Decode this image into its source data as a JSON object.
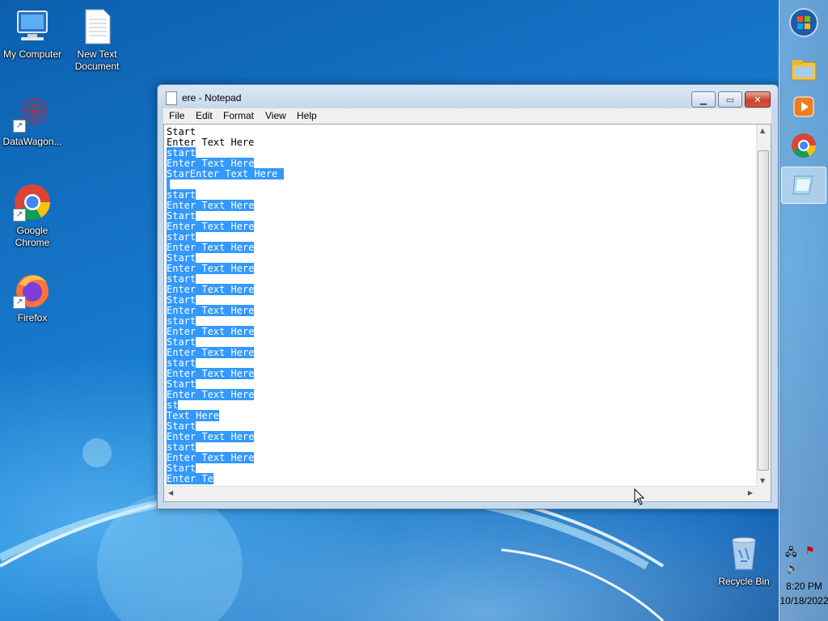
{
  "desktop": {
    "icons": [
      {
        "label": "My Computer",
        "icon": "computer-icon"
      },
      {
        "label": "New Text Document",
        "icon": "text-document-icon"
      },
      {
        "label": "DataWagon...",
        "icon": "datawagon-icon"
      },
      {
        "label": "Google Chrome",
        "icon": "chrome-icon"
      },
      {
        "label": "Firefox",
        "icon": "firefox-icon"
      },
      {
        "label": "Recycle Bin",
        "icon": "recycle-bin-icon"
      }
    ]
  },
  "notepad": {
    "title": "ere - Notepad",
    "menu": [
      "File",
      "Edit",
      "Format",
      "View",
      "Help"
    ],
    "lines": [
      {
        "text": "Start",
        "selected": false
      },
      {
        "text": "Enter Text Here",
        "selected": false
      },
      {
        "text": "start",
        "selected": true
      },
      {
        "text": "Enter Text Here",
        "selected": true
      },
      {
        "text": "StarEnter Text Here ",
        "selected": true
      },
      {
        "text": "",
        "selected": true
      },
      {
        "text": "start",
        "selected": true
      },
      {
        "text": "Enter Text Here",
        "selected": true
      },
      {
        "text": "Start",
        "selected": true
      },
      {
        "text": "Enter Text Here",
        "selected": true
      },
      {
        "text": "start",
        "selected": true
      },
      {
        "text": "Enter Text Here",
        "selected": true
      },
      {
        "text": "Start",
        "selected": true
      },
      {
        "text": "Enter Text Here",
        "selected": true
      },
      {
        "text": "start",
        "selected": true
      },
      {
        "text": "Enter Text Here",
        "selected": true
      },
      {
        "text": "Start",
        "selected": true
      },
      {
        "text": "Enter Text Here",
        "selected": true
      },
      {
        "text": "start",
        "selected": true
      },
      {
        "text": "Enter Text Here",
        "selected": true
      },
      {
        "text": "Start",
        "selected": true
      },
      {
        "text": "Enter Text Here",
        "selected": true
      },
      {
        "text": "start",
        "selected": true
      },
      {
        "text": "Enter Text Here",
        "selected": true
      },
      {
        "text": "Start",
        "selected": true
      },
      {
        "text": "Enter Text Here",
        "selected": true
      },
      {
        "text": "st",
        "selected": true
      },
      {
        "text": "Text Here",
        "selected": true
      },
      {
        "text": "Start",
        "selected": true
      },
      {
        "text": "Enter Text Here",
        "selected": true
      },
      {
        "text": "start",
        "selected": true
      },
      {
        "text": "Enter Text Here",
        "selected": true
      },
      {
        "text": "Start",
        "selected": true
      },
      {
        "text": "Enter Te",
        "selected": true
      }
    ],
    "selection_color": "#3399ff"
  },
  "taskbar": {
    "items": [
      "start-orb-icon",
      "file-explorer-icon",
      "media-player-icon",
      "chrome-icon",
      "notepad-icon"
    ],
    "active_item": "notepad-icon",
    "time": "8:20 PM",
    "date": "10/18/2022"
  }
}
